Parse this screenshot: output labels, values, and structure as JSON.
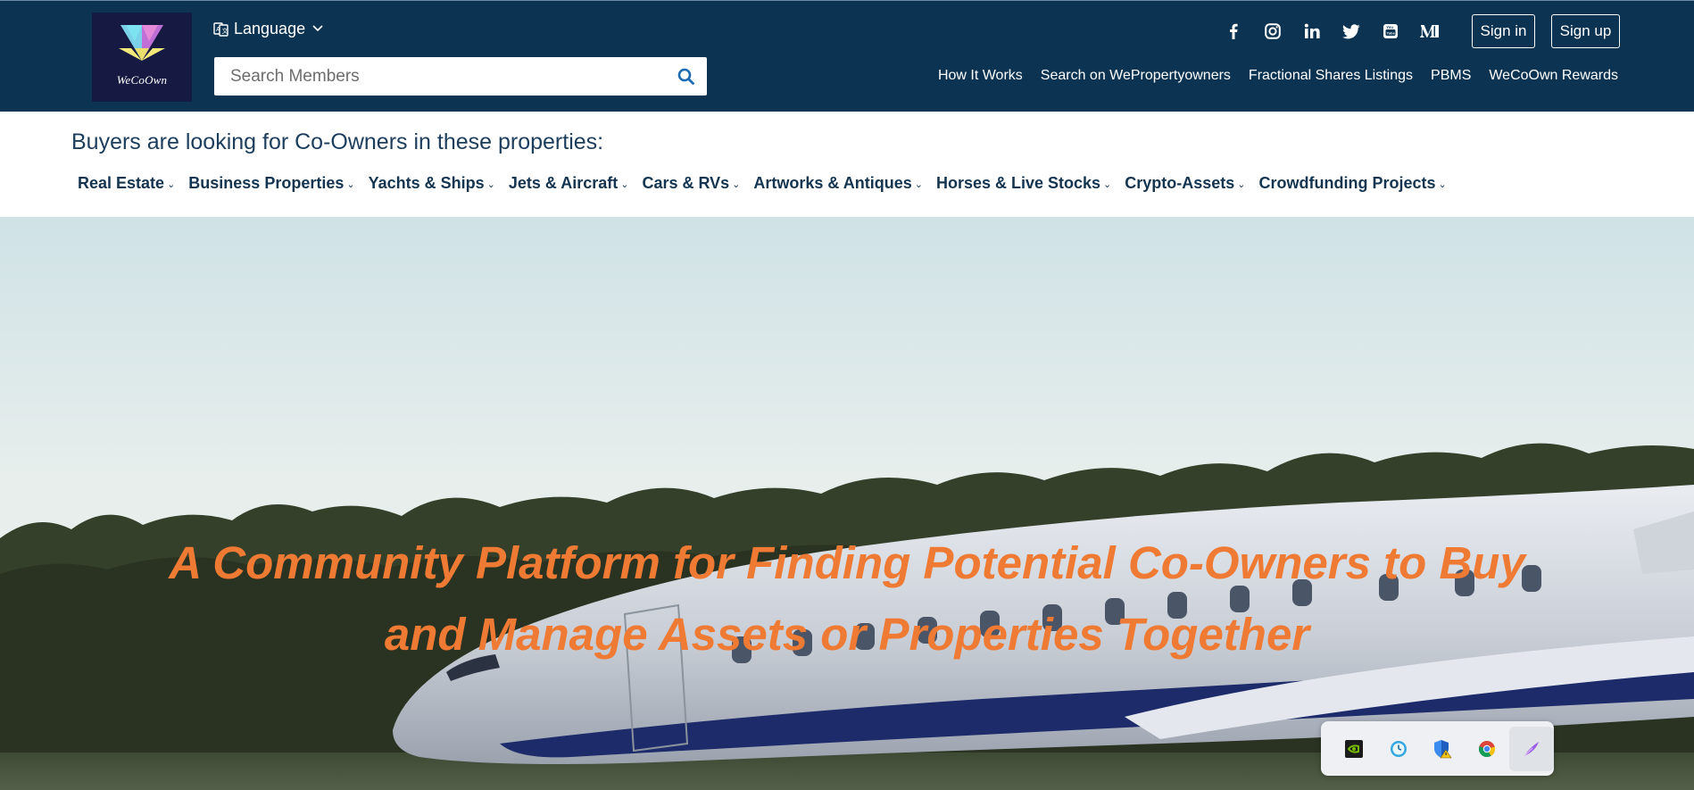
{
  "brand": {
    "logo_text": "WeCoOwn"
  },
  "header": {
    "language_label": "Language",
    "search_placeholder": "Search Members",
    "signin_label": "Sign in",
    "signup_label": "Sign up",
    "socials": [
      "facebook-icon",
      "instagram-icon",
      "linkedin-icon",
      "twitter-icon",
      "youtube-icon",
      "medium-icon"
    ],
    "nav": [
      {
        "label": "How It Works"
      },
      {
        "label": "Search on WePropertyowners"
      },
      {
        "label": "Fractional Shares Listings"
      },
      {
        "label": "PBMS"
      },
      {
        "label": "WeCoOwn Rewards"
      }
    ]
  },
  "categories": {
    "heading": "Buyers are looking for Co-Owners in these properties:",
    "items": [
      {
        "label": "Real Estate"
      },
      {
        "label": "Business Properties"
      },
      {
        "label": "Yachts & Ships"
      },
      {
        "label": "Jets & Aircraft"
      },
      {
        "label": "Cars & RVs"
      },
      {
        "label": "Artworks & Antiques"
      },
      {
        "label": "Horses & Live Stocks"
      },
      {
        "label": "Crypto-Assets"
      },
      {
        "label": "Crowdfunding Projects"
      }
    ]
  },
  "hero": {
    "title_line1": "A Community Platform for Finding Potential Co-Owners to Buy",
    "title_line2": "and Manage Assets or Properties Together"
  },
  "tray": {
    "icons": [
      "nvidia-icon",
      "clock-app-icon",
      "security-shield-icon",
      "chrome-icon",
      "feather-pen-icon"
    ]
  },
  "colors": {
    "header_bg": "#0c3452",
    "hero_text": "#ef7a33",
    "category_text": "#14344f"
  }
}
